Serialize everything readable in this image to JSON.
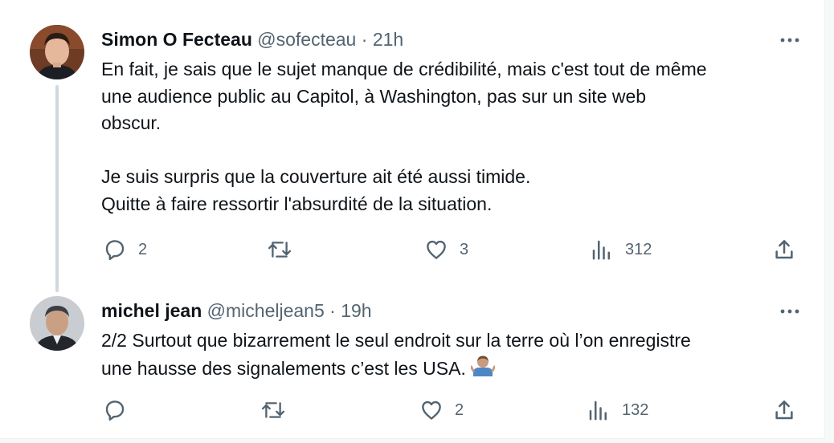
{
  "tweets": [
    {
      "author_name": "Simon O Fecteau",
      "handle": "@sofecteau",
      "separator": "·",
      "time": "21h",
      "body": [
        "En fait, je sais que le sujet manque de crédibilité, mais c'est tout de même",
        "une audience public au Capitol, à Washington, pas sur un site web",
        "obscur.",
        "",
        "Je suis surpris que la couverture ait été aussi timide.",
        "Quitte à faire ressortir l'absurdité de la situation."
      ],
      "replies": "2",
      "retweets": "",
      "likes": "3",
      "views": "312"
    },
    {
      "author_name": "michel jean",
      "handle": "@micheljean5",
      "separator": "·",
      "time": "19h",
      "body": [
        "2/2 Surtout que bizarrement le seul endroit sur la terre où l’on enregistre",
        "une hausse des signalements c’est les USA."
      ],
      "emoji": "person-shrugging",
      "replies": "",
      "retweets": "",
      "likes": "2",
      "views": "132"
    }
  ],
  "colors": {
    "text": "#0f1419",
    "secondary": "#536471",
    "thread_line": "#cfd9de",
    "background": "#ffffff"
  },
  "icons": [
    "more-icon",
    "reply-icon",
    "retweet-icon",
    "like-icon",
    "views-icon",
    "share-icon",
    "shrug-emoji"
  ]
}
